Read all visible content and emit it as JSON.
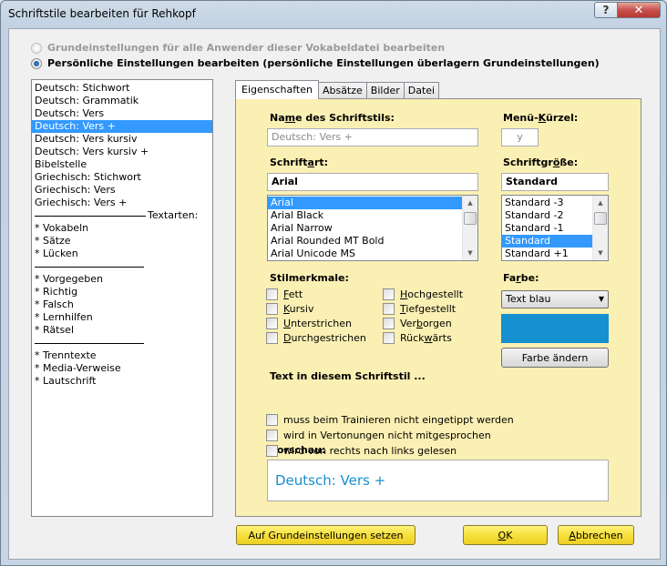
{
  "window": {
    "title": "Schriftstile bearbeiten für Rehkopf",
    "help_label": "?",
    "close_label": "✕"
  },
  "scope": {
    "option_global": "Grundeinstellungen für alle Anwender dieser Vokabeldatei bearbeiten",
    "option_personal": "Persönliche Einstellungen bearbeiten (persönliche Einstellungen überlagern Grundeinstellungen)",
    "selected": "personal"
  },
  "style_list": {
    "items": [
      "Deutsch: Stichwort",
      "Deutsch: Grammatik",
      "Deutsch: Vers",
      "Deutsch: Vers +",
      "Deutsch: Vers kursiv",
      "Deutsch: Vers kursiv +",
      "Bibelstelle",
      "Griechisch: Stichwort",
      "Griechisch: Vers",
      "Griechisch: Vers +"
    ],
    "selected_index": 3,
    "separator_label": "Textarten:",
    "group1": [
      "* Vokabeln",
      "* Sätze",
      "* Lücken"
    ],
    "group2": [
      "* Vorgegeben",
      "* Richtig",
      "* Falsch",
      "* Lernhilfen",
      "* Rätsel"
    ],
    "group3": [
      "* Trenntexte",
      "* Media-Verweise",
      "* Lautschrift"
    ]
  },
  "tabs": [
    "Eigenschaften",
    "Absätze",
    "Bilder",
    "Datei"
  ],
  "properties": {
    "name_label_pre": "Na",
    "name_label_u": "m",
    "name_label_post": "e des Schriftstils:",
    "name_value": "Deutsch: Vers +",
    "shortcut_label_pre": "Menü-",
    "shortcut_label_u": "K",
    "shortcut_label_post": "ürzel:",
    "shortcut_value": "y",
    "font_label_pre": "Schrift",
    "font_label_u": "a",
    "font_label_post": "rt:",
    "font_value": "Arial",
    "fonts": [
      "Arial",
      "Arial Black",
      "Arial Narrow",
      "Arial Rounded MT Bold",
      "Arial Unicode MS"
    ],
    "size_label_pre": "Schriftgr",
    "size_label_u": "ö",
    "size_label_post": "ße:",
    "size_value": "Standard",
    "sizes": [
      "Standard -3",
      "Standard -2",
      "Standard -1",
      "Standard",
      "Standard +1"
    ],
    "size_selected_index": 3,
    "style_label": "Stilmerkmale:",
    "styles_left": [
      {
        "u": "F",
        "rest": "ett",
        "pre": ""
      },
      {
        "u": "K",
        "rest": "ursiv",
        "pre": ""
      },
      {
        "u": "U",
        "rest": "nterstrichen",
        "pre": ""
      },
      {
        "u": "D",
        "rest": "urchgestrichen",
        "pre": ""
      }
    ],
    "styles_right": [
      {
        "pre": "",
        "u": "H",
        "rest": "ochgestellt"
      },
      {
        "pre": "",
        "u": "T",
        "rest": "iefgestellt"
      },
      {
        "pre": "Ver",
        "u": "b",
        "rest": "orgen"
      },
      {
        "pre": "Rück",
        "u": "w",
        "rest": "ärts"
      }
    ],
    "color_label_pre": "Fa",
    "color_label_u": "r",
    "color_label_post": "be:",
    "color_value": "Text blau",
    "color_hex": "#1690cf",
    "color_button": "Farbe ändern",
    "text_options_label": "Text in diesem Schriftstil ...",
    "text_options": [
      "muss beim Trainieren nicht eingetippt werden",
      "wird in Vertonungen nicht mitgesprochen",
      "wird von rechts nach links gelesen"
    ],
    "preview_label": "Vorschau:",
    "preview_text": "Deutsch: Vers +",
    "panel_color": "#fbf0b3"
  },
  "footer": {
    "reset_button": "Auf Grundeinstellungen setzen",
    "ok_label_u": "O",
    "ok_label_rest": "K",
    "cancel_label_u": "A",
    "cancel_label_rest": "bbrechen"
  }
}
